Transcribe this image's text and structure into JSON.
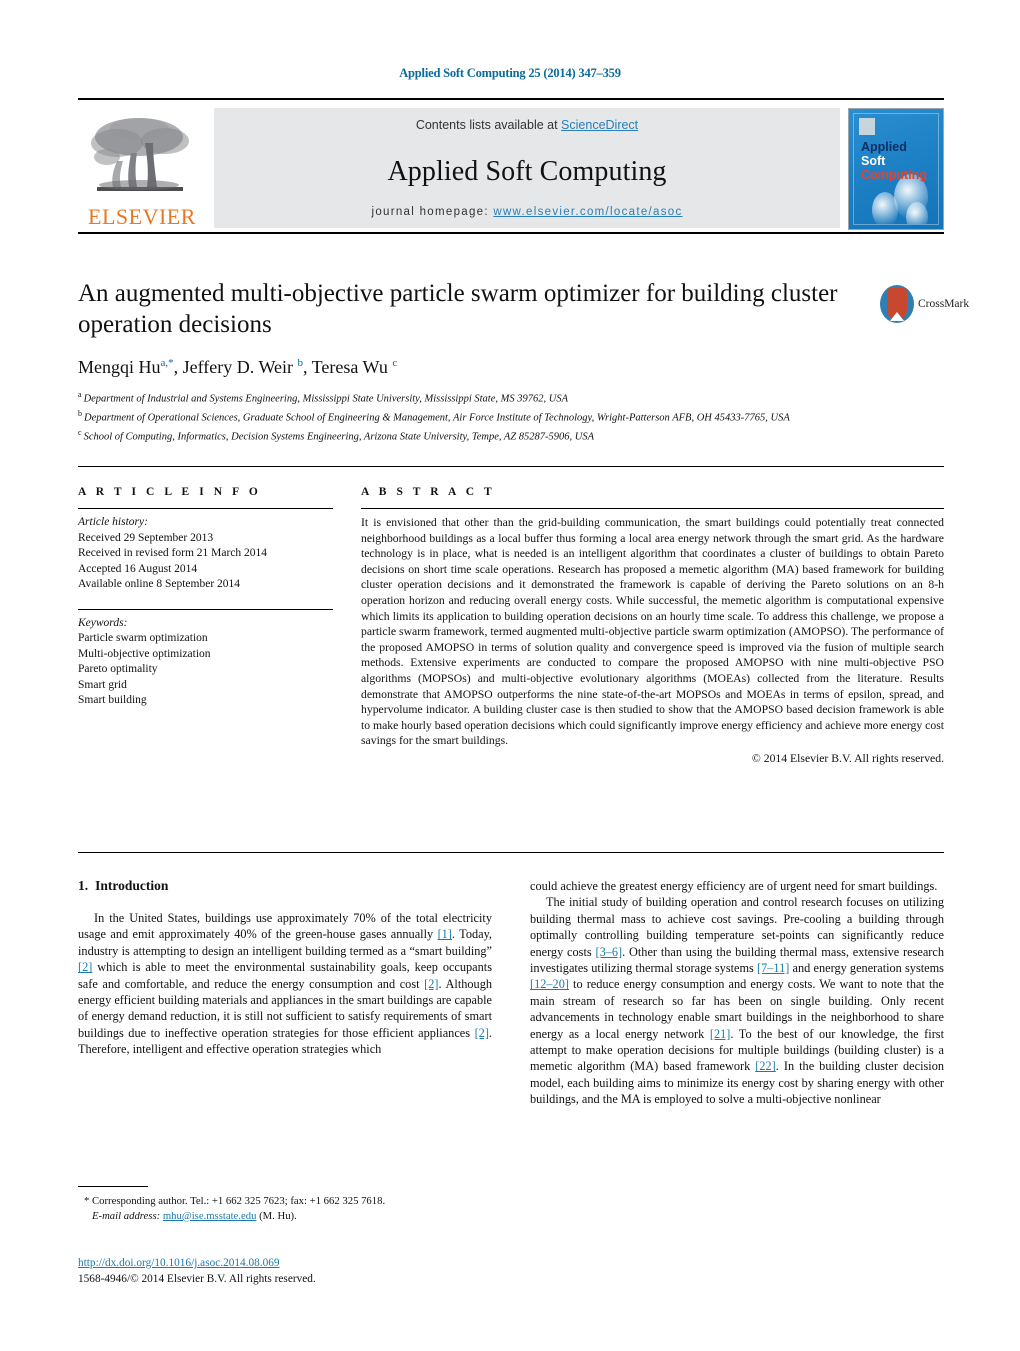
{
  "running_head": "Applied Soft Computing 25 (2014) 347–359",
  "masthead": {
    "publisher_name": "ELSEVIER",
    "contents_prefix": "Contents lists available at ",
    "contents_link": "ScienceDirect",
    "journal_title": "Applied Soft Computing",
    "homepage_prefix": "journal homepage: ",
    "homepage_url": "www.elsevier.com/locate/asoc",
    "cover": {
      "line1": "Applied",
      "line2": "Soft",
      "line3": "Computing"
    }
  },
  "article": {
    "title": "An augmented multi-objective particle swarm optimizer for building cluster operation decisions",
    "crossmark_label": "CrossMark",
    "authors_html": "Mengqi Hu<sup>a,*</sup>, Jeffery D. Weir <sup>b</sup>, Teresa Wu <sup>c</sup>",
    "affiliations": [
      "Department of Industrial and Systems Engineering, Mississippi State University, Mississippi State, MS 39762, USA",
      "Department of Operational Sciences, Graduate School of Engineering & Management, Air Force Institute of Technology, Wright-Patterson AFB, OH 45433-7765, USA",
      "School of Computing, Informatics, Decision Systems Engineering, Arizona State University, Tempe, AZ 85287-5906, USA"
    ],
    "affiliation_marks": [
      "a",
      "b",
      "c"
    ]
  },
  "article_info": {
    "heading": "A R T I C L E   I N F O",
    "history_label": "Article history:",
    "history": [
      "Received 29 September 2013",
      "Received in revised form 21 March 2014",
      "Accepted 16 August 2014",
      "Available online 8 September 2014"
    ],
    "keywords_label": "Keywords:",
    "keywords": [
      "Particle swarm optimization",
      "Multi-objective optimization",
      "Pareto optimality",
      "Smart grid",
      "Smart building"
    ]
  },
  "abstract": {
    "heading": "A B S T R A C T",
    "text": "It is envisioned that other than the grid-building communication, the smart buildings could potentially treat connected neighborhood buildings as a local buffer thus forming a local area energy network through the smart grid. As the hardware technology is in place, what is needed is an intelligent algorithm that coordinates a cluster of buildings to obtain Pareto decisions on short time scale operations. Research has proposed a memetic algorithm (MA) based framework for building cluster operation decisions and it demonstrated the framework is capable of deriving the Pareto solutions on an 8-h operation horizon and reducing overall energy costs. While successful, the memetic algorithm is computational expensive which limits its application to building operation decisions on an hourly time scale. To address this challenge, we propose a particle swarm framework, termed augmented multi-objective particle swarm optimization (AMOPSO). The performance of the proposed AMOPSO in terms of solution quality and convergence speed is improved via the fusion of multiple search methods. Extensive experiments are conducted to compare the proposed AMOPSO with nine multi-objective PSO algorithms (MOPSOs) and multi-objective evolutionary algorithms (MOEAs) collected from the literature. Results demonstrate that AMOPSO outperforms the nine state-of-the-art MOPSOs and MOEAs in terms of epsilon, spread, and hypervolume indicator. A building cluster case is then studied to show that the AMOPSO based decision framework is able to make hourly based operation decisions which could significantly improve energy efficiency and achieve more energy cost savings for the smart buildings.",
    "copyright": "© 2014 Elsevier B.V. All rights reserved."
  },
  "body": {
    "section_number": "1.",
    "section_title": "Introduction",
    "left_paragraphs": [
      "In the United States, buildings use approximately 70% of the total electricity usage and emit approximately 40% of the green-house gases annually [1]. Today, industry is attempting to design an intelligent building termed as a “smart building” [2] which is able to meet the environmental sustainability goals, keep occupants safe and comfortable, and reduce the energy consumption and cost [2]. Although energy efficient building materials and appliances in the smart buildings are capable of energy demand reduction, it is still not sufficient to satisfy requirements of smart buildings due to ineffective operation strategies for those efficient appliances [2]. Therefore, intelligent and effective operation strategies which"
    ],
    "right_paragraphs": [
      "could achieve the greatest energy efficiency are of urgent need for smart buildings.",
      "The initial study of building operation and control research focuses on utilizing building thermal mass to achieve cost savings. Pre-cooling a building through optimally controlling building temperature set-points can significantly reduce energy costs [3–6]. Other than using the building thermal mass, extensive research investigates utilizing thermal storage systems [7–11] and energy generation systems [12–20] to reduce energy consumption and energy costs. We want to note that the main stream of research so far has been on single building. Only recent advancements in technology enable smart buildings in the neighborhood to share energy as a local energy network [21]. To the best of our knowledge, the first attempt to make operation decisions for multiple buildings (building cluster) is a memetic algorithm (MA) based framework [22]. In the building cluster decision model, each building aims to minimize its energy cost by sharing energy with other buildings, and the MA is employed to solve a multi-objective nonlinear"
    ]
  },
  "footnote": {
    "star": "*",
    "corresponding": "Corresponding author. Tel.: +1 662 325 7623; fax: +1 662 325 7618.",
    "email_label": "E-mail address:",
    "email": "mhu@ise.msstate.edu",
    "email_suffix": "(M. Hu)."
  },
  "footer": {
    "doi": "http://dx.doi.org/10.1016/j.asoc.2014.08.069",
    "issn": "1568-4946/© 2014 Elsevier B.V. All rights reserved."
  },
  "colors": {
    "link": "#1a7ba8",
    "header_blue": "#0a6a9a",
    "elsevier_orange": "#e87722",
    "cover_blue": "#1e81c6",
    "crossmark_red": "#c8472f"
  }
}
